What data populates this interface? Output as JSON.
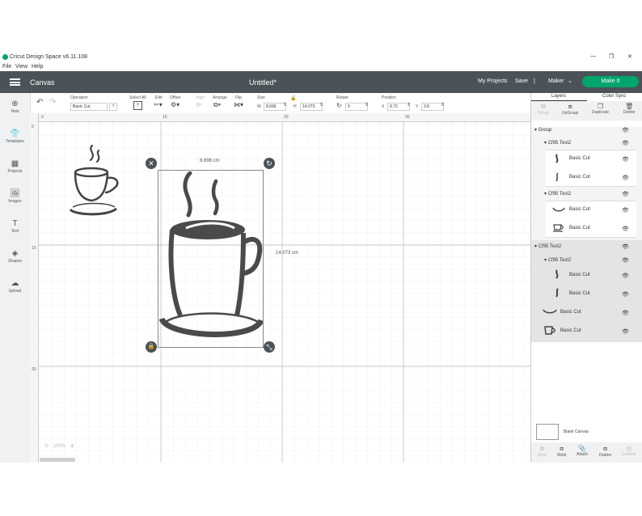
{
  "window": {
    "title": "Cricut Design Space  v6.11.108",
    "min": "—",
    "max": "❐",
    "close": "✕"
  },
  "menu": [
    "File",
    "View",
    "Help"
  ],
  "header": {
    "section": "Canvas",
    "title": "Untitled*",
    "my_projects": "My Projects",
    "save": "Save",
    "separator": "|",
    "machine": "Maker",
    "make_it": "Make It"
  },
  "toolbar": {
    "operation_label": "Operation",
    "operation_value": "Basic Cut",
    "select_all": "Select All",
    "edit": "Edit",
    "offset": "Offset",
    "align": "Align",
    "arrange": "Arrange",
    "flip": "Flip",
    "size_label": "Size",
    "w_label": "W",
    "w_value": "8.696",
    "h_label": "H",
    "h_value": "14.073",
    "rotate_label": "Rotate",
    "rotate_value": "0",
    "position_label": "Position",
    "x_label": "X",
    "x_value": "9.72",
    "y_label": "Y",
    "y_value": "3.8"
  },
  "sidebar": {
    "items": [
      {
        "label": "New",
        "icon": "plus-icon"
      },
      {
        "label": "Templates",
        "icon": "shirt-icon"
      },
      {
        "label": "Projects",
        "icon": "projects-icon"
      },
      {
        "label": "Images",
        "icon": "image-icon"
      },
      {
        "label": "Text",
        "icon": "text-icon"
      },
      {
        "label": "Shapes",
        "icon": "shapes-icon"
      },
      {
        "label": "Upload",
        "icon": "upload-icon"
      }
    ]
  },
  "ruler": {
    "h": [
      "0",
      "10",
      "20",
      "30"
    ],
    "v": [
      "0",
      "10",
      "20"
    ]
  },
  "canvas": {
    "width_label": "8.696 cm",
    "height_label": "14.073 cm",
    "zoom": "100%"
  },
  "rightpanel": {
    "tabs": [
      "Layers",
      "Color Sync"
    ],
    "actions": [
      "Group",
      "UnGroup",
      "Duplicate",
      "Delete"
    ],
    "layers": [
      {
        "label": "Group"
      },
      {
        "label": "Cf95 Test2"
      },
      {
        "label": "Basic Cut"
      },
      {
        "label": "Basic Cut"
      },
      {
        "label": "Cf95 Test2"
      },
      {
        "label": "Basic Cut"
      },
      {
        "label": "Basic Cut"
      },
      {
        "label": "Cf95 Test2"
      },
      {
        "label": "Cf95 Test2"
      },
      {
        "label": "Basic Cut"
      },
      {
        "label": "Basic Cut"
      },
      {
        "label": "Basic Cut"
      },
      {
        "label": "Basic Cut"
      }
    ],
    "blank_canvas": "Blank Canvas",
    "bottom_actions": [
      "Slice",
      "Weld",
      "Attach",
      "Flatten",
      "Contour"
    ]
  }
}
